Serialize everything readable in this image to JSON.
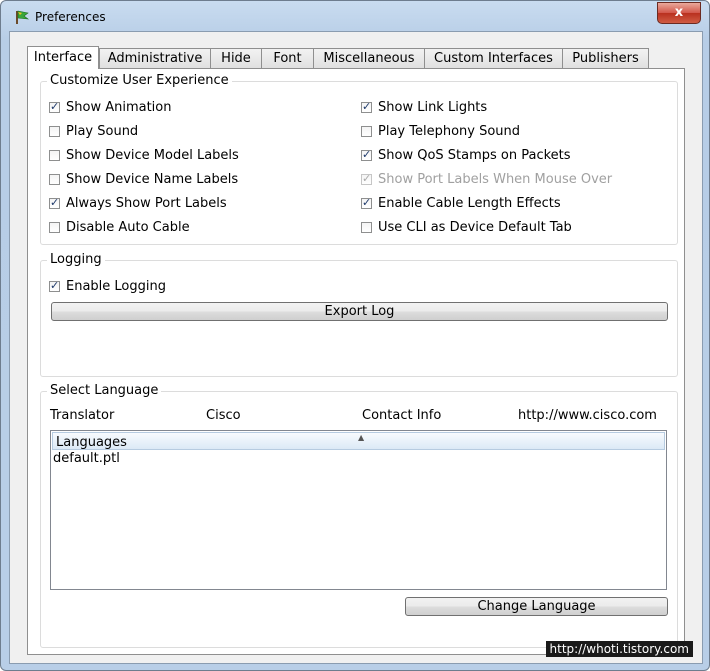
{
  "window": {
    "title": "Preferences",
    "close_label": "x",
    "icon": "packet-tracer-app-icon"
  },
  "tabs": [
    {
      "label": "Interface",
      "active": true
    },
    {
      "label": "Administrative"
    },
    {
      "label": "Hide"
    },
    {
      "label": "Font"
    },
    {
      "label": "Miscellaneous"
    },
    {
      "label": "Custom Interfaces"
    },
    {
      "label": "Publishers"
    }
  ],
  "customize": {
    "legend": "Customize User Experience",
    "options": [
      {
        "label": "Show Animation",
        "checked": true
      },
      {
        "label": "Show Link Lights",
        "checked": true
      },
      {
        "label": "Play Sound",
        "checked": false
      },
      {
        "label": "Play Telephony Sound",
        "checked": false
      },
      {
        "label": "Show Device Model Labels",
        "checked": false
      },
      {
        "label": "Show QoS Stamps on Packets",
        "checked": true
      },
      {
        "label": "Show Device Name Labels",
        "checked": false
      },
      {
        "label": "Show Port Labels When Mouse Over",
        "checked": true,
        "disabled": true
      },
      {
        "label": "Always Show Port Labels",
        "checked": true
      },
      {
        "label": "Enable Cable Length Effects",
        "checked": true
      },
      {
        "label": "Disable Auto Cable",
        "checked": false
      },
      {
        "label": "Use CLI as Device Default Tab",
        "checked": false
      }
    ]
  },
  "logging": {
    "legend": "Logging",
    "enable_label": "Enable Logging",
    "enable_checked": true,
    "export_label": "Export Log"
  },
  "language": {
    "legend": "Select Language",
    "translator_label": "Translator",
    "translator_value": "Cisco",
    "contact_label": "Contact Info",
    "contact_value": "http://www.cisco.com",
    "list_header": "Languages",
    "items": [
      "default.ptl"
    ],
    "change_label": "Change Language"
  },
  "watermark": "http://whoti.tistory.com"
}
